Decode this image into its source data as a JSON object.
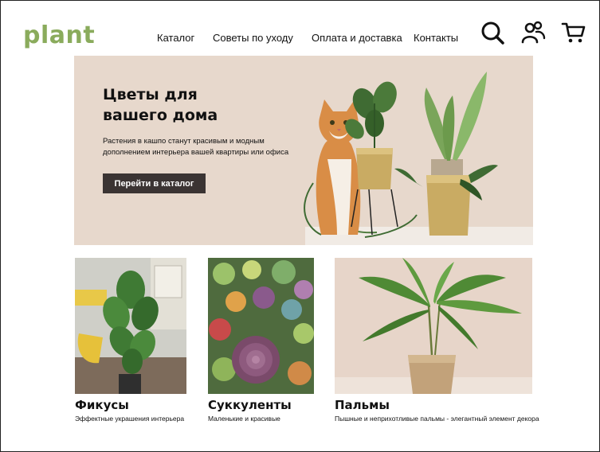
{
  "brand": {
    "logo": "plant",
    "color": "#8aab5c"
  },
  "nav": {
    "items": [
      {
        "label": "Каталог"
      },
      {
        "label": "Советы по уходу"
      },
      {
        "label": "Оплата и доставка"
      },
      {
        "label": "Контакты"
      }
    ]
  },
  "header_icons": [
    "search-icon",
    "account-icon",
    "cart-icon"
  ],
  "hero": {
    "title_line1": "Цветы для",
    "title_line2": "вашего дома",
    "text": "Растения в кашпо станут красивым и модным дополнением интерьера вашей квартиры или офиса",
    "button": "Перейти в каталог",
    "background": "#e7d8cc",
    "button_color": "#3b3433"
  },
  "categories": [
    {
      "title": "Фикусы",
      "subtitle": "Эффектные украшения интерьера"
    },
    {
      "title": "Суккуленты",
      "subtitle": "Маленькие и красивые"
    },
    {
      "title": "Пальмы",
      "subtitle": "Пышные и неприхотливые пальмы - элегантный элемент декора"
    }
  ]
}
